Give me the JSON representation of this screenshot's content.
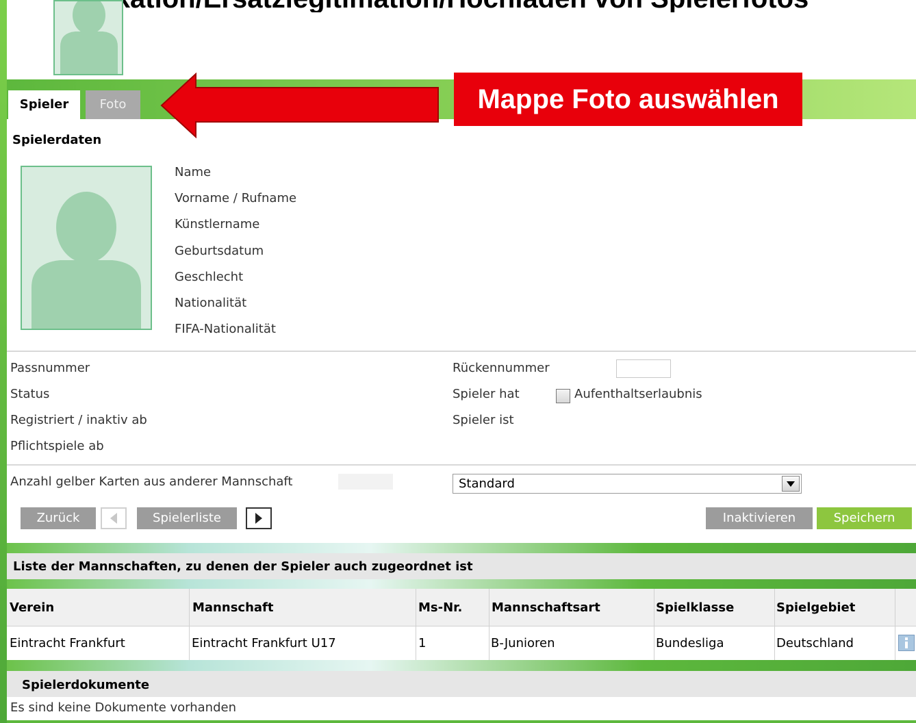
{
  "page": {
    "heading": "ikation/Ersatzlegitimation/Hochladen von Spielerfotos"
  },
  "tabs": {
    "spieler": "Spieler",
    "foto": "Foto"
  },
  "callout": {
    "text": "Mappe Foto auswählen"
  },
  "section_title": "Spielerdaten",
  "player_fields": [
    "Name",
    "Vorname / Rufname",
    "Künstlername",
    "Geburtsdatum",
    "Geschlecht",
    "Nationalität",
    "FIFA-Nationalität"
  ],
  "left_fields": [
    "Passnummer",
    "Status",
    "Registriert / inaktiv ab",
    "Pflichtspiele ab"
  ],
  "right_fields": {
    "rueckennummer": "Rückennummer",
    "spieler_hat": "Spieler hat",
    "aufenthalt": "Aufenthaltserlaubnis",
    "spieler_ist": "Spieler ist"
  },
  "yellow_cards_label": "Anzahl gelber Karten aus anderer Mannschaft",
  "select": {
    "value": "Standard"
  },
  "buttons": {
    "zurueck": "Zurück",
    "spielerliste": "Spielerliste",
    "inaktivieren": "Inaktivieren",
    "speichern": "Speichern"
  },
  "teams": {
    "title": "Liste der Mannschaften, zu denen der Spieler auch zugeordnet ist",
    "headers": [
      "Verein",
      "Mannschaft",
      "Ms-Nr.",
      "Mannschaftsart",
      "Spielklasse",
      "Spielgebiet"
    ],
    "rows": [
      [
        "Eintracht Frankfurt",
        "Eintracht Frankfurt U17",
        "1",
        "B-Junioren",
        "Bundesliga",
        "Deutschland"
      ]
    ]
  },
  "documents": {
    "title": "Spielerdokumente",
    "empty": "Es sind keine Dokumente vorhanden"
  },
  "icons": {
    "arrow": "left-arrow-icon",
    "avatar": "person-silhouette-icon",
    "info": "info-icon"
  },
  "colors": {
    "green": "#5db83d",
    "lime_button": "#8dc63f",
    "red": "#e8000b",
    "gray_button": "#9c9c9c"
  }
}
